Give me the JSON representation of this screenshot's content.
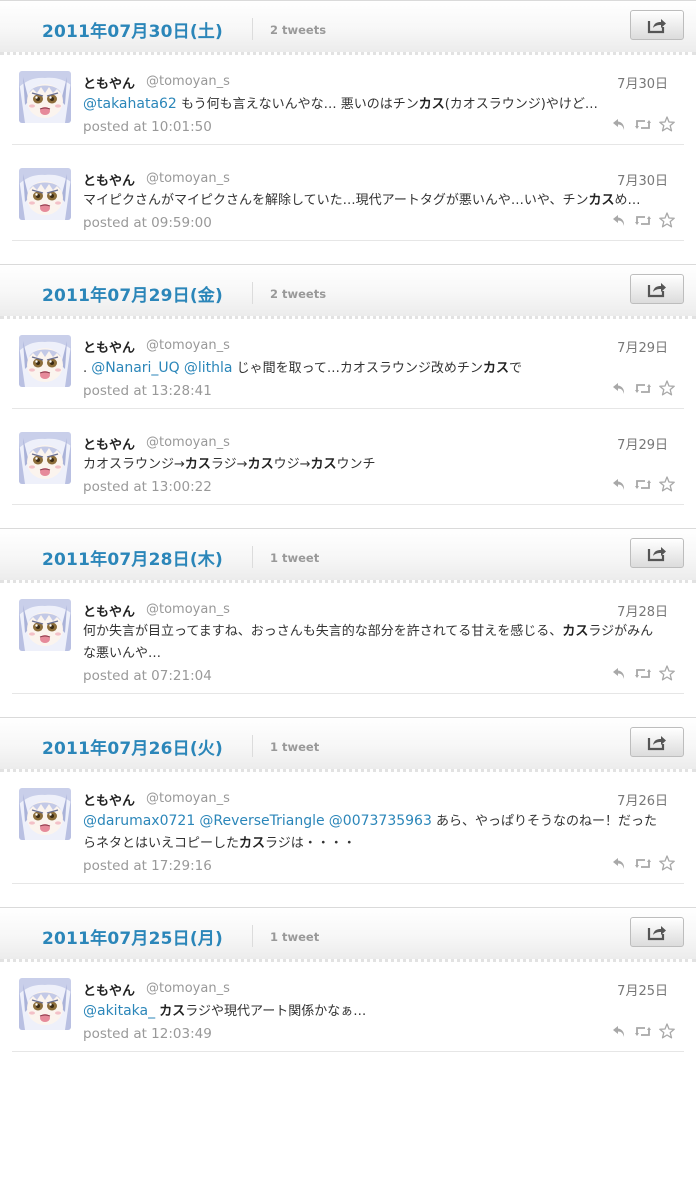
{
  "days": [
    {
      "date": "2011年07月30日(土)",
      "count": "2 tweets",
      "tweets": [
        {
          "name": "ともやん",
          "handle": "@tomoyan_s",
          "date": "7月30日",
          "segments": [
            {
              "t": "mention",
              "v": "@takahata62"
            },
            {
              "t": "text",
              "v": " もう何も言えないんやな… 悪いのはチン"
            },
            {
              "t": "bold",
              "v": "カス"
            },
            {
              "t": "text",
              "v": "(カオスラウンジ)やけど…"
            }
          ],
          "time": "posted at 10:01:50"
        },
        {
          "name": "ともやん",
          "handle": "@tomoyan_s",
          "date": "7月30日",
          "segments": [
            {
              "t": "text",
              "v": "マイピクさんがマイピクさんを解除していた…現代アートタグが悪いんや…いや、チン"
            },
            {
              "t": "bold",
              "v": "カス"
            },
            {
              "t": "text",
              "v": "め…"
            }
          ],
          "time": "posted at 09:59:00"
        }
      ]
    },
    {
      "date": "2011年07月29日(金)",
      "count": "2 tweets",
      "tweets": [
        {
          "name": "ともやん",
          "handle": "@tomoyan_s",
          "date": "7月29日",
          "segments": [
            {
              "t": "text",
              "v": ". "
            },
            {
              "t": "mention",
              "v": "@Nanari_UQ"
            },
            {
              "t": "text",
              "v": " "
            },
            {
              "t": "mention",
              "v": "@lithla"
            },
            {
              "t": "text",
              "v": " じゃ間を取って…カオスラウンジ改めチン"
            },
            {
              "t": "bold",
              "v": "カス"
            },
            {
              "t": "text",
              "v": "で"
            }
          ],
          "time": "posted at 13:28:41"
        },
        {
          "name": "ともやん",
          "handle": "@tomoyan_s",
          "date": "7月29日",
          "segments": [
            {
              "t": "text",
              "v": "カオスラウンジ→"
            },
            {
              "t": "bold",
              "v": "カス"
            },
            {
              "t": "text",
              "v": "ラジ→"
            },
            {
              "t": "bold",
              "v": "カス"
            },
            {
              "t": "text",
              "v": "ウジ→"
            },
            {
              "t": "bold",
              "v": "カス"
            },
            {
              "t": "text",
              "v": "ウンチ"
            }
          ],
          "time": "posted at 13:00:22"
        }
      ]
    },
    {
      "date": "2011年07月28日(木)",
      "count": "1 tweet",
      "tweets": [
        {
          "name": "ともやん",
          "handle": "@tomoyan_s",
          "date": "7月28日",
          "segments": [
            {
              "t": "text",
              "v": "何か失言が目立ってますね、おっさんも失言的な部分を許されてる甘えを感じる、"
            },
            {
              "t": "bold",
              "v": "カス"
            },
            {
              "t": "text",
              "v": "ラジがみんな悪いんや…"
            }
          ],
          "time": "posted at 07:21:04"
        }
      ]
    },
    {
      "date": "2011年07月26日(火)",
      "count": "1 tweet",
      "tweets": [
        {
          "name": "ともやん",
          "handle": "@tomoyan_s",
          "date": "7月26日",
          "segments": [
            {
              "t": "mention",
              "v": "@darumax0721"
            },
            {
              "t": "text",
              "v": " "
            },
            {
              "t": "mention",
              "v": "@ReverseTriangle"
            },
            {
              "t": "text",
              "v": " "
            },
            {
              "t": "mention",
              "v": "@0073735963"
            },
            {
              "t": "text",
              "v": " あら、やっぱりそうなのねー！だったらネタとはいえコピーした"
            },
            {
              "t": "bold",
              "v": "カス"
            },
            {
              "t": "text",
              "v": "ラジは・・・・"
            }
          ],
          "time": "posted at 17:29:16"
        }
      ]
    },
    {
      "date": "2011年07月25日(月)",
      "count": "1 tweet",
      "tweets": [
        {
          "name": "ともやん",
          "handle": "@tomoyan_s",
          "date": "7月25日",
          "segments": [
            {
              "t": "mention",
              "v": "@akitaka_"
            },
            {
              "t": "text",
              "v": " "
            },
            {
              "t": "bold",
              "v": "カス"
            },
            {
              "t": "text",
              "v": "ラジや現代アート関係かなぁ…"
            }
          ],
          "time": "posted at 12:03:49"
        }
      ]
    }
  ],
  "icons": {
    "share": "share-icon",
    "reply": "reply-icon",
    "retweet": "retweet-icon",
    "favorite": "star-icon",
    "avatar": "avatar-anime-girl"
  },
  "colors": {
    "accent": "#2b86b9",
    "muted": "#999999",
    "border": "#e6e6e6"
  }
}
